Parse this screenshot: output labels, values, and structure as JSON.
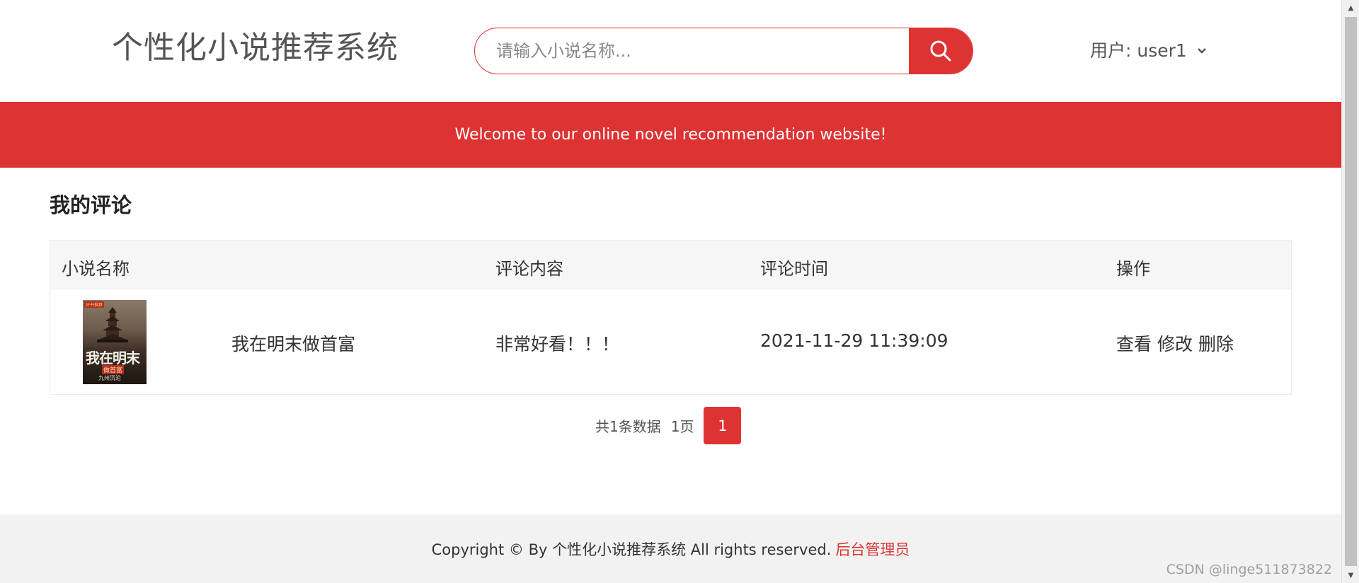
{
  "header": {
    "logo_text": "个性化小说推荐系统",
    "search_placeholder": "请输入小说名称...",
    "search_value": "",
    "search_icon": "search-icon",
    "user_label": "用户: user1",
    "user_dropdown_icon": "chevron-down-icon"
  },
  "banner": {
    "text": "Welcome to our online novel recommendation website!"
  },
  "section": {
    "title": "我的评论"
  },
  "table": {
    "columns": [
      "小说名称",
      "评论内容",
      "评论时间",
      "操作"
    ],
    "rows": [
      {
        "cover": {
          "tag": "好书推荐",
          "title": "我在明末",
          "subtitle": "做首富",
          "author": "九州沉沦"
        },
        "novel_name": "我在明末做首富",
        "comment": "非常好看！！！",
        "time": "2021-11-29 11:39:09",
        "actions": [
          "查看",
          "修改",
          "删除"
        ]
      }
    ]
  },
  "pagination": {
    "total_text": "共1条数据",
    "pages_text": "1页",
    "current_page": "1"
  },
  "footer": {
    "copyright": "Copyright © By 个性化小说推荐系统 All rights reserved.",
    "admin_link": "后台管理员"
  },
  "watermark": "CSDN @linge511873822",
  "colors": {
    "accent": "#dd3333",
    "footer_bg": "#f2f2f2",
    "table_header_bg": "#f6f6f6"
  }
}
